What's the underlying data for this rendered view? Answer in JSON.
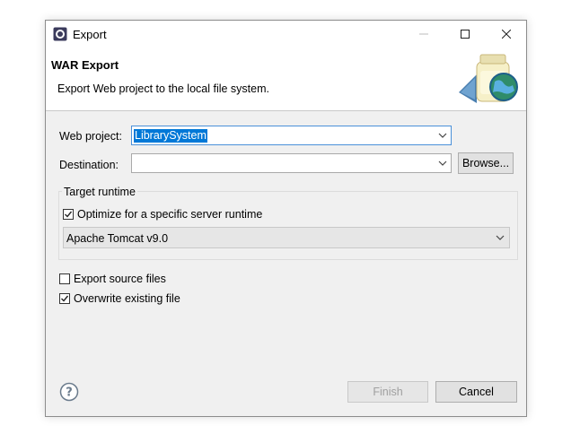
{
  "window": {
    "title": "Export",
    "icons": [
      "app-icon",
      "minimize-icon",
      "maximize-icon",
      "close-icon"
    ]
  },
  "banner": {
    "title": "WAR Export",
    "description": "Export Web project to the local file system.",
    "image_icon": "export-jar-globe-icon"
  },
  "form": {
    "web_project_label": "Web project:",
    "web_project_value": "LibrarySystem",
    "destination_label": "Destination:",
    "destination_value": "",
    "browse_label": "Browse..."
  },
  "target_runtime": {
    "group_label": "Target runtime",
    "optimize_label": "Optimize for a specific server runtime",
    "optimize_checked": true,
    "runtime_value": "Apache Tomcat v9.0"
  },
  "options": {
    "export_source_label": "Export source files",
    "export_source_checked": false,
    "overwrite_label": "Overwrite existing file",
    "overwrite_checked": true
  },
  "footer": {
    "help_icon": "help-icon",
    "finish_label": "Finish",
    "finish_enabled": false,
    "cancel_label": "Cancel"
  },
  "colors": {
    "dialog_bg": "#f0f0f0",
    "selection": "#0078d7",
    "focus_border": "#4a90d9"
  }
}
